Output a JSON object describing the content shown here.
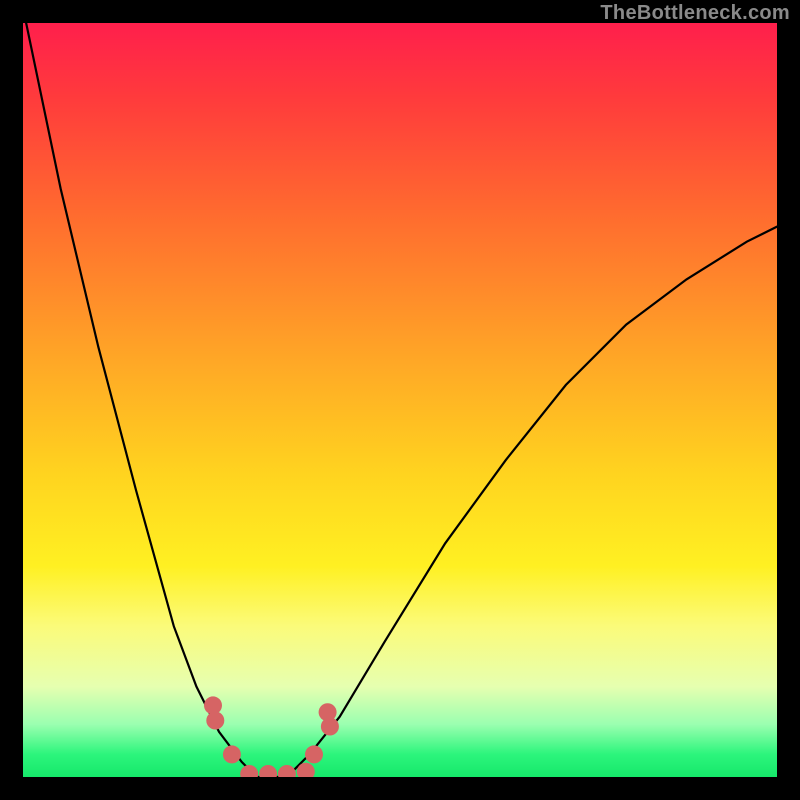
{
  "watermark": "TheBottleneck.com",
  "chart_data": {
    "type": "line",
    "title": "",
    "xlabel": "",
    "ylabel": "",
    "xlim": [
      0,
      100
    ],
    "ylim": [
      0,
      100
    ],
    "grid": false,
    "legend": false,
    "series": [
      {
        "name": "bottleneck-curve",
        "stroke": "#000000",
        "x": [
          0,
          5,
          10,
          15,
          20,
          23,
          26,
          29,
          31,
          33,
          35,
          38,
          42,
          48,
          56,
          64,
          72,
          80,
          88,
          96,
          100
        ],
        "y": [
          102,
          78,
          57,
          38,
          20,
          12,
          6,
          2,
          0,
          0,
          0,
          3,
          8,
          18,
          31,
          42,
          52,
          60,
          66,
          71,
          73
        ]
      }
    ],
    "markers": [
      {
        "name": "left-upper",
        "x": 25.2,
        "y": 9.5,
        "r": 1.2,
        "color": "#d66464"
      },
      {
        "name": "left-lower",
        "x": 25.5,
        "y": 7.5,
        "r": 1.2,
        "color": "#d66464"
      },
      {
        "name": "left-floor",
        "x": 27.7,
        "y": 3.0,
        "r": 1.2,
        "color": "#d66464"
      },
      {
        "name": "floor-a",
        "x": 30.0,
        "y": 0.4,
        "r": 1.2,
        "color": "#d66464"
      },
      {
        "name": "floor-b",
        "x": 32.5,
        "y": 0.4,
        "r": 1.2,
        "color": "#d66464"
      },
      {
        "name": "floor-c",
        "x": 35.0,
        "y": 0.4,
        "r": 1.2,
        "color": "#d66464"
      },
      {
        "name": "floor-d",
        "x": 37.5,
        "y": 0.7,
        "r": 1.2,
        "color": "#d66464"
      },
      {
        "name": "right-floor",
        "x": 38.6,
        "y": 3.0,
        "r": 1.2,
        "color": "#d66464"
      },
      {
        "name": "right-upper",
        "x": 40.4,
        "y": 8.6,
        "r": 1.2,
        "color": "#d66464"
      },
      {
        "name": "right-upper2",
        "x": 40.7,
        "y": 6.7,
        "r": 1.2,
        "color": "#d66464"
      }
    ],
    "gradient_stops": [
      {
        "pct": 0,
        "color": "#ff1f4c"
      },
      {
        "pct": 10,
        "color": "#ff3b3c"
      },
      {
        "pct": 25,
        "color": "#ff6a2f"
      },
      {
        "pct": 45,
        "color": "#ffa826"
      },
      {
        "pct": 60,
        "color": "#ffd41f"
      },
      {
        "pct": 72,
        "color": "#fff022"
      },
      {
        "pct": 80,
        "color": "#fbfb7a"
      },
      {
        "pct": 88,
        "color": "#e6ffb0"
      },
      {
        "pct": 93,
        "color": "#9bffb0"
      },
      {
        "pct": 97,
        "color": "#2cf57c"
      },
      {
        "pct": 100,
        "color": "#16e86a"
      }
    ]
  }
}
